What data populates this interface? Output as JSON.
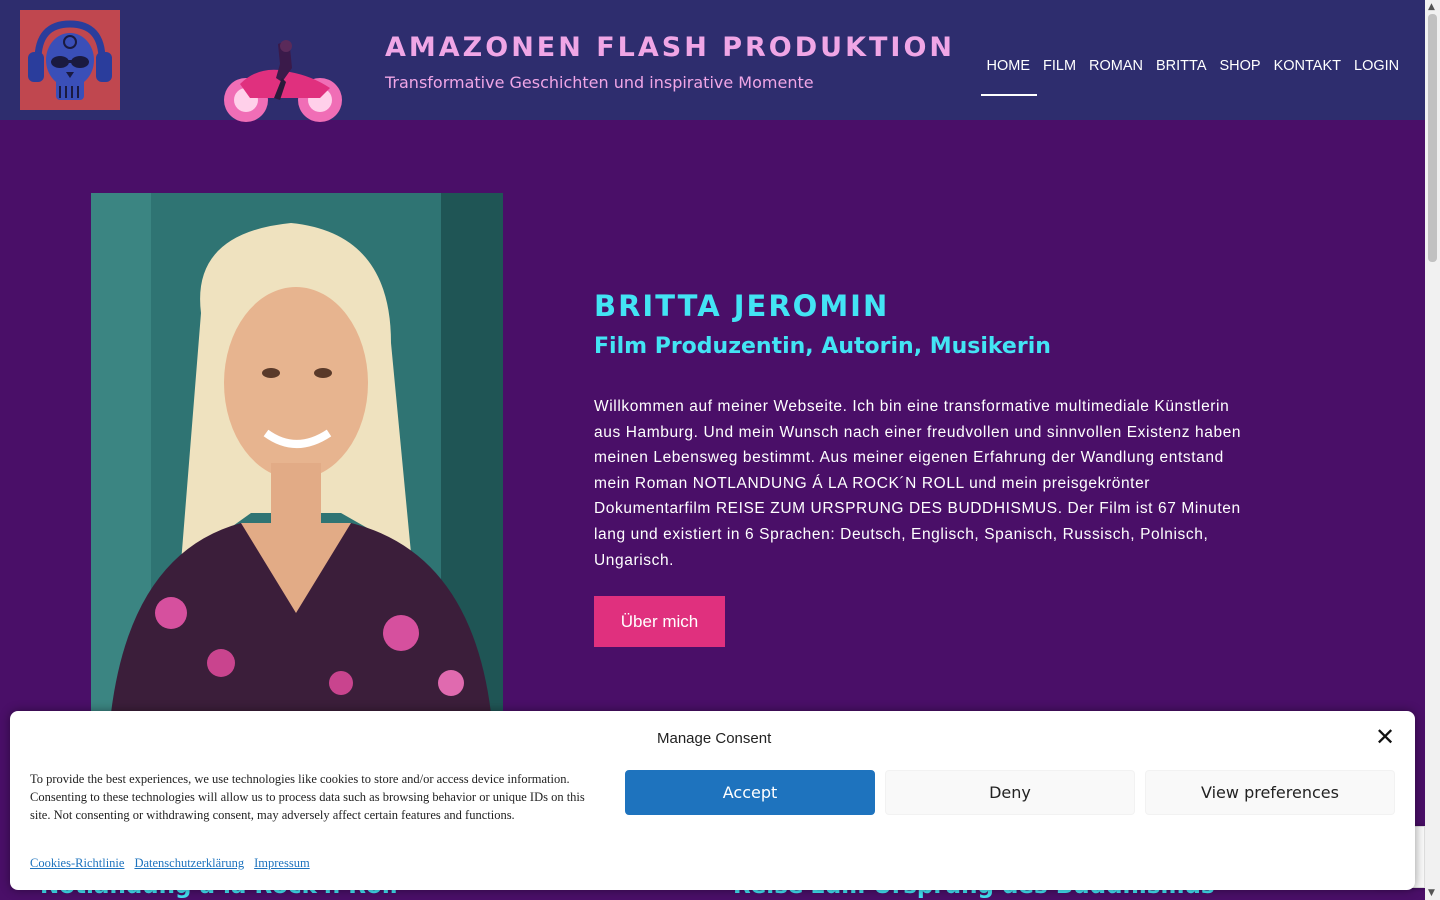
{
  "header": {
    "title": "AMAZONEN FLASH PRODUKTION",
    "tagline": "Transformative Geschichten und inspirative Momente",
    "logo_icon": "skull-headphones-icon",
    "bike_icon": "motorbike-rider-icon",
    "background_color": "#2e2d6e",
    "title_color": "#f0a6e6"
  },
  "nav": {
    "items": [
      "HOME",
      "FILM",
      "ROMAN",
      "BRITTA",
      "SHOP",
      "KONTAKT",
      "LOGIN"
    ],
    "active": "HOME"
  },
  "hero": {
    "name": "BRITTA JEROMIN",
    "subtitle": "Film Produzentin, Autorin, Musikerin",
    "text": "Willkommen auf meiner Webseite. Ich bin eine transformative multimediale Künstlerin aus Hamburg. Und mein Wunsch nach einer freudvollen und sinnvollen Existenz haben meinen Lebensweg bestimmt. Aus meiner eigenen Erfahrung der Wandlung entstand mein Roman NOTLANDUNG Á LA ROCK´N ROLL und mein preisgekrönter Dokumentarfilm REISE ZUM URSPRUNG DES BUDDHISMUS. Der Film ist 67 Minuten lang und existiert in 6 Sprachen: Deutsch, Englisch, Spanisch, Russisch, Polnisch, Ungarisch.",
    "button_label": "Über mich",
    "background_color": "#4a0f68",
    "accent_color": "#43e4f4",
    "button_color": "#e0307e"
  },
  "below_fold": {
    "left_heading": "Notlandung à la Rock'n Roll",
    "right_heading": "Reise zum Ursprung des Buddhismus"
  },
  "consent": {
    "title": "Manage Consent",
    "close_icon": "close-icon",
    "text": "To provide the best experiences, we use technologies like cookies to store and/or access device information. Consenting to these technologies will allow us to process data such as browsing behavior or unique IDs on this site. Not consenting or withdrawing consent, may adversely affect certain features and functions.",
    "accept_label": "Accept",
    "deny_label": "Deny",
    "preferences_label": "View preferences",
    "links": [
      "Cookies-Richtlinie",
      "Datenschutzerklärung",
      "Impressum"
    ],
    "accept_color": "#1e73be"
  }
}
